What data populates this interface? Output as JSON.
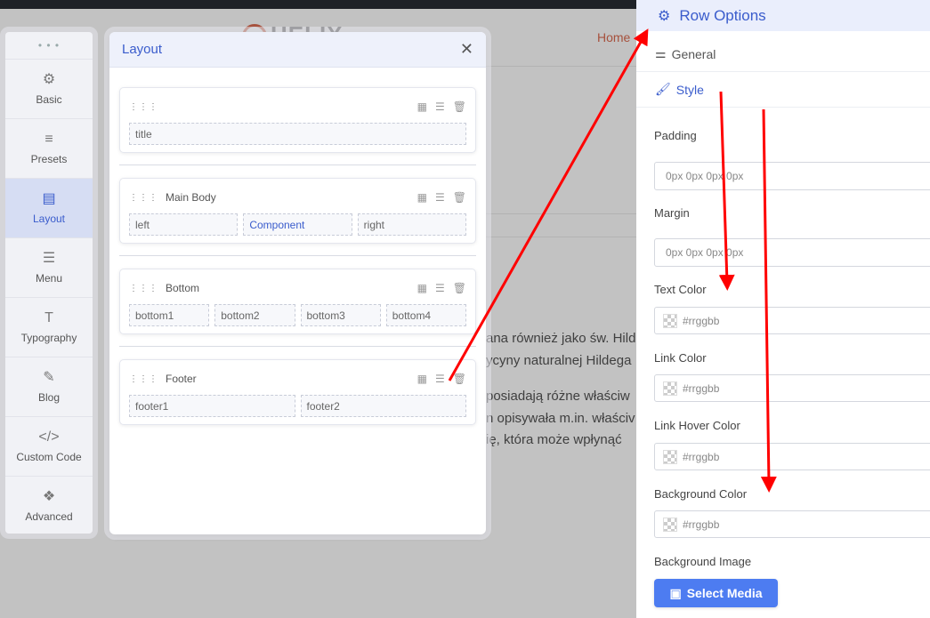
{
  "site": {
    "logo_text": "HELIX",
    "home_link": "Home",
    "article_lines": [
      "ana również jako św. Hild",
      "ycyny naturalnej Hildega",
      "posiadają różne właściw",
      "n opisywała m.in. właściv",
      "ię, która może wpłynąć"
    ]
  },
  "tools": {
    "items": [
      {
        "id": "basic",
        "label": "Basic",
        "icon": "gear-icon",
        "glyph": "⚙"
      },
      {
        "id": "presets",
        "label": "Presets",
        "icon": "sliders-icon",
        "glyph": "≡"
      },
      {
        "id": "layout",
        "label": "Layout",
        "icon": "layout-icon",
        "glyph": "▤"
      },
      {
        "id": "menu",
        "label": "Menu",
        "icon": "menu-icon",
        "glyph": "☰"
      },
      {
        "id": "typography",
        "label": "Typography",
        "icon": "typography-icon",
        "glyph": "T"
      },
      {
        "id": "blog",
        "label": "Blog",
        "icon": "blog-icon",
        "glyph": "✎"
      },
      {
        "id": "custom-code",
        "label": "Custom Code",
        "icon": "code-icon",
        "glyph": "</>"
      },
      {
        "id": "advanced",
        "label": "Advanced",
        "icon": "advanced-icon",
        "glyph": "❖"
      }
    ],
    "active": "layout"
  },
  "layout_panel": {
    "title": "Layout",
    "close_glyph": "✕",
    "rows": [
      {
        "name": "",
        "columns": [
          "title"
        ]
      },
      {
        "name": "Main Body",
        "columns": [
          "left",
          "Component",
          "right"
        ]
      },
      {
        "name": "Bottom",
        "columns": [
          "bottom1",
          "bottom2",
          "bottom3",
          "bottom4"
        ]
      },
      {
        "name": "Footer",
        "columns": [
          "footer1",
          "footer2"
        ]
      }
    ]
  },
  "row_options": {
    "title": "Row Options",
    "tabs": [
      {
        "label": "General",
        "icon": "sliders-icon",
        "glyph": "⚌"
      },
      {
        "label": "Style",
        "icon": "brush-icon",
        "glyph": "🖌"
      }
    ],
    "active_tab": "Style",
    "padding": {
      "label": "Padding",
      "placeholder": "0px 0px 0px 0px"
    },
    "margin": {
      "label": "Margin",
      "placeholder": "0px 0px 0px 0px"
    },
    "text_color": {
      "label": "Text Color",
      "placeholder": "#rrggbb"
    },
    "link_color": {
      "label": "Link Color",
      "placeholder": "#rrggbb"
    },
    "link_hover_color": {
      "label": "Link Hover Color",
      "placeholder": "#rrggbb"
    },
    "background_color": {
      "label": "Background Color",
      "placeholder": "#rrggbb"
    },
    "background_image": {
      "label": "Background Image",
      "button": "Select Media"
    }
  },
  "colors": {
    "accent": "#3a5ccc",
    "button": "#4d7cf1",
    "annotation": "#ff0000"
  }
}
